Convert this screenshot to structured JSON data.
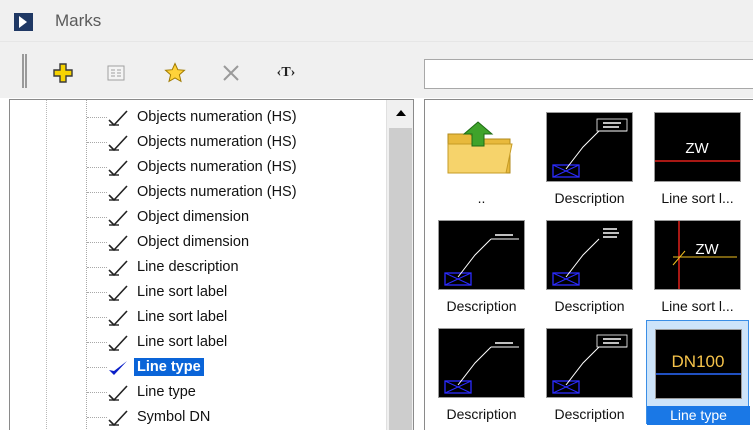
{
  "window": {
    "title": "Marks"
  },
  "toolbar": {
    "buttons": [
      {
        "icon": "add-plus-icon"
      },
      {
        "icon": "properties-list-icon"
      },
      {
        "icon": "favorite-star-icon"
      },
      {
        "icon": "delete-x-icon"
      },
      {
        "icon": "text-tag-icon",
        "text": "‹T›"
      }
    ],
    "search": {
      "value": "",
      "placeholder": ""
    }
  },
  "tree": {
    "items": [
      {
        "label": "Objects numeration (HS)",
        "selected": false
      },
      {
        "label": "Objects numeration (HS)",
        "selected": false
      },
      {
        "label": "Objects numeration (HS)",
        "selected": false
      },
      {
        "label": "Objects numeration (HS)",
        "selected": false
      },
      {
        "label": "Object dimension",
        "selected": false
      },
      {
        "label": "Object dimension",
        "selected": false
      },
      {
        "label": "Line description",
        "selected": false
      },
      {
        "label": "Line sort label",
        "selected": false
      },
      {
        "label": "Line sort label",
        "selected": false
      },
      {
        "label": "Line sort label",
        "selected": false
      },
      {
        "label": "Line type",
        "selected": true
      },
      {
        "label": "Line type",
        "selected": false
      },
      {
        "label": "Symbol DN",
        "selected": false
      }
    ]
  },
  "gallery": {
    "tiles": [
      {
        "caption": "..",
        "thumb": "folder-up",
        "selected": false
      },
      {
        "caption": "Description",
        "thumb": "desc-boxed-text",
        "selected": false
      },
      {
        "caption": "Line sort l...",
        "thumb_text": "ZW",
        "thumb": "zw-horizontal",
        "selected": false
      },
      {
        "caption": "Description",
        "thumb": "desc-article-line",
        "selected": false
      },
      {
        "caption": "Description",
        "thumb": "desc-stacked-text",
        "selected": false
      },
      {
        "caption": "Line sort l...",
        "thumb_text": "ZW",
        "thumb": "zw-crossed",
        "selected": false
      },
      {
        "caption": "Description",
        "thumb": "desc-article-line",
        "selected": false
      },
      {
        "caption": "Description",
        "thumb": "desc-boxed-text",
        "selected": false
      },
      {
        "caption": "Line type",
        "thumb_text": "DN100",
        "thumb": "dn100",
        "selected": true
      }
    ]
  }
}
